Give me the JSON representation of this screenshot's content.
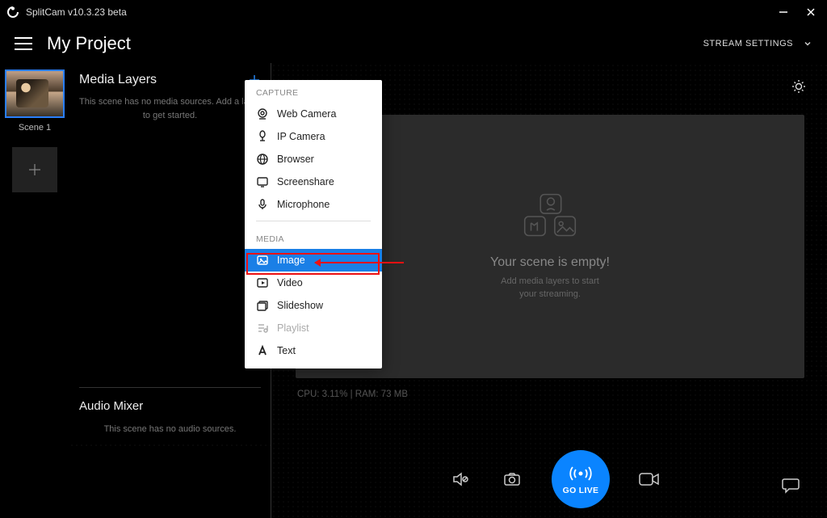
{
  "titlebar": {
    "app_name": "SplitCam v10.3.23 beta"
  },
  "projectbar": {
    "title": "My Project",
    "stream_settings": "STREAM SETTINGS"
  },
  "scenes": {
    "items": [
      {
        "label": "Scene 1"
      }
    ]
  },
  "media": {
    "header": "Media Layers",
    "empty": "This scene has no media sources. Add a layer to get started."
  },
  "audio": {
    "header": "Audio Mixer",
    "empty": "This scene has no audio sources."
  },
  "popup": {
    "capture_label": "CAPTURE",
    "media_label": "MEDIA",
    "capture_items": [
      {
        "label": "Web Camera"
      },
      {
        "label": "IP Camera"
      },
      {
        "label": "Browser"
      },
      {
        "label": "Screenshare"
      },
      {
        "label": "Microphone"
      }
    ],
    "media_items": [
      {
        "label": "Image"
      },
      {
        "label": "Video"
      },
      {
        "label": "Slideshow"
      },
      {
        "label": "Playlist"
      },
      {
        "label": "Text"
      }
    ]
  },
  "preview": {
    "empty_title": "Your scene is empty!",
    "empty_sub_1": "Add media layers to start",
    "empty_sub_2": "your streaming."
  },
  "stats": {
    "line": "CPU: 3.11% | RAM: 73 MB"
  },
  "dock": {
    "go_live": "GO LIVE"
  }
}
